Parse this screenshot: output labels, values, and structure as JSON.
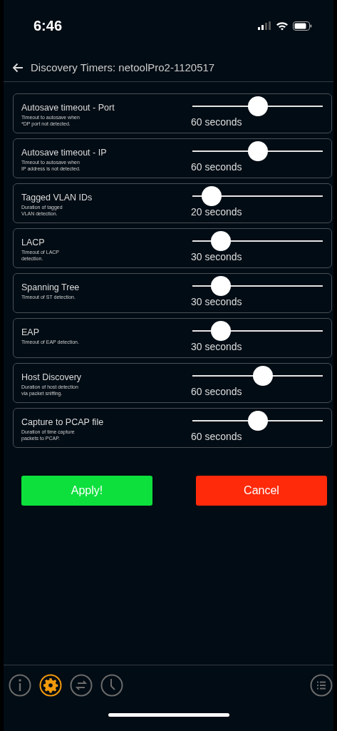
{
  "status_bar": {
    "time": "6:46"
  },
  "header": {
    "title": "Discovery Timers: netoolPro2-1120517"
  },
  "timers": [
    {
      "name": "Autosave timeout - Port",
      "description": "Timeout to autosave when\n*DP port not detected.",
      "level": 0.5,
      "reading": "60 seconds"
    },
    {
      "name": "Autosave timeout - IP",
      "description": "Timeout to autosave when\nIP address is not detected.",
      "level": 0.5,
      "reading": "60 seconds"
    },
    {
      "name": "Tagged VLAN IDs",
      "description": "Duration of tagged\nVLAN detection.",
      "level": 0.15,
      "reading": "20 seconds"
    },
    {
      "name": "LACP",
      "description": "Timeout of LACP\ndetection.",
      "level": 0.22,
      "reading": "30 seconds"
    },
    {
      "name": "Spanning Tree",
      "description": "Timeout of ST detection.",
      "level": 0.22,
      "reading": "30 seconds"
    },
    {
      "name": "EAP",
      "description": "Timeout of EAP detection.",
      "level": 0.22,
      "reading": "30 seconds"
    },
    {
      "name": "Host Discovery",
      "description": "Duration of host detection\nvia packet sniffing.",
      "level": 0.54,
      "reading": "60 seconds"
    },
    {
      "name": "Capture to PCAP file",
      "description": "Duration of time capture\npackets to PCAP.",
      "level": 0.5,
      "reading": "60 seconds"
    }
  ],
  "buttons": [
    {
      "label": "Apply!",
      "kind": "apply"
    },
    {
      "label": "Cancel",
      "kind": "cancel"
    }
  ],
  "tab_bar": [
    {
      "kind": "info",
      "selected": false
    },
    {
      "kind": "settings",
      "selected": true
    },
    {
      "kind": "transfer",
      "selected": false
    },
    {
      "kind": "history",
      "selected": false
    },
    {
      "kind": "list",
      "selected": false
    }
  ]
}
